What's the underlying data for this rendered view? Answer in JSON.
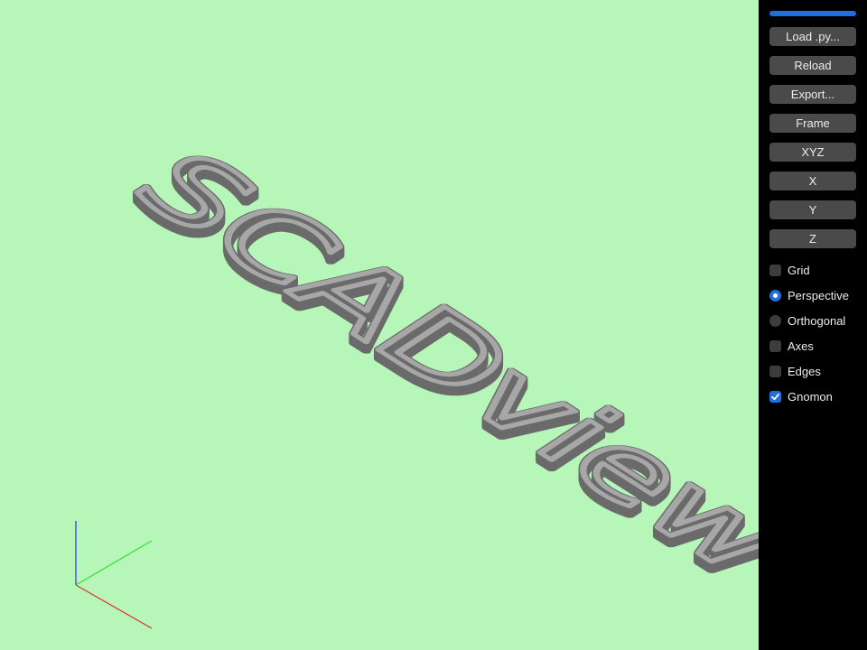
{
  "progress": {
    "value": 1.0,
    "color": "#1f6fe0"
  },
  "viewport": {
    "background": "#b6f7b9",
    "text": "SCADview",
    "model_color": "#9a9a9a",
    "axis_colors": {
      "x": "#e03030",
      "y": "#30e030",
      "z": "#3030e0"
    }
  },
  "buttons": [
    {
      "name": "load-py-button",
      "label": "Load .py..."
    },
    {
      "name": "reload-button",
      "label": "Reload"
    },
    {
      "name": "export-button",
      "label": "Export..."
    },
    {
      "name": "frame-button",
      "label": "Frame"
    },
    {
      "name": "view-xyz-button",
      "label": "XYZ"
    },
    {
      "name": "view-x-button",
      "label": "X"
    },
    {
      "name": "view-y-button",
      "label": "Y"
    },
    {
      "name": "view-z-button",
      "label": "Z"
    }
  ],
  "options": [
    {
      "name": "grid-checkbox",
      "label": "Grid",
      "kind": "checkbox",
      "checked": false
    },
    {
      "name": "perspective-radio",
      "label": "Perspective",
      "kind": "radio",
      "checked": true
    },
    {
      "name": "orthogonal-radio",
      "label": "Orthogonal",
      "kind": "radio",
      "checked": false
    },
    {
      "name": "axes-checkbox",
      "label": "Axes",
      "kind": "checkbox",
      "checked": false
    },
    {
      "name": "edges-checkbox",
      "label": "Edges",
      "kind": "checkbox",
      "checked": false
    },
    {
      "name": "gnomon-checkbox",
      "label": "Gnomon",
      "kind": "checkbox",
      "checked": true
    }
  ]
}
